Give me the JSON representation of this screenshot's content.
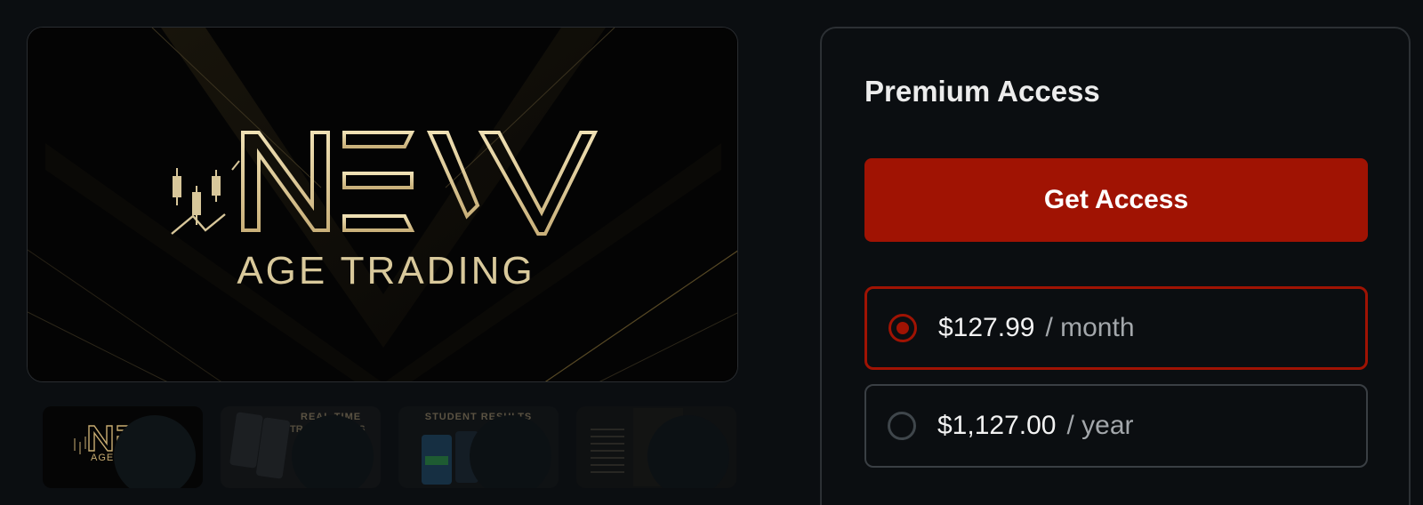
{
  "hero": {
    "logo_mark": "NEW",
    "logo_text": "AGE TRADING",
    "icon": "candlestick-chart-icon"
  },
  "thumbnails": [
    {
      "label": "AGE",
      "kind": "logo"
    },
    {
      "label": "REAL TIME",
      "label2": "TRADE ALERTS",
      "kind": "screens"
    },
    {
      "label": "STUDENT RESULTS",
      "kind": "results"
    },
    {
      "label": "",
      "kind": "checklist"
    }
  ],
  "pricing": {
    "title": "Premium Access",
    "cta_label": "Get Access",
    "options": [
      {
        "price": "$127.99",
        "period": "/ month",
        "selected": true
      },
      {
        "price": "$1,127.00",
        "period": "/ year",
        "selected": false
      }
    ]
  },
  "colors": {
    "background": "#0b0e11",
    "accent": "#a01303",
    "gold": "#d8c79a"
  }
}
